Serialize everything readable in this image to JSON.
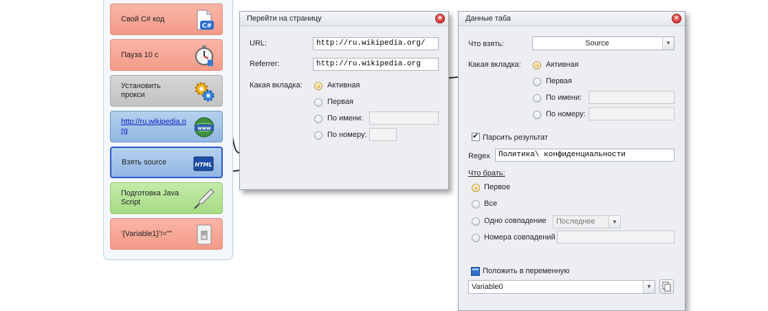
{
  "actions": [
    {
      "label": "Свой C# код",
      "icon": "csharp-code-icon",
      "color": "red"
    },
    {
      "label": "Пауза 10 с",
      "icon": "stopwatch-icon",
      "color": "red"
    },
    {
      "label": "Установить прокси",
      "icon": "gears-icon",
      "color": "gray"
    },
    {
      "label": "http://ru.wikipedia.org",
      "icon": "www-globe-icon",
      "color": "blue"
    },
    {
      "label": "Взять source",
      "icon": "html-icon",
      "color": "blue-selected"
    },
    {
      "label": "Подготовка Java Script",
      "icon": "pen-nib-icon",
      "color": "green"
    },
    {
      "label": "'{Variable1}'!=\"\"",
      "icon": "switch-icon",
      "color": "red"
    }
  ],
  "navigate_dialog": {
    "title": "Перейти на страницу",
    "url_label": "URL:",
    "url_value": "http://ru.wikipedia.org/",
    "referrer_label": "Referrer:",
    "referrer_value": "http://ru.wikipedia.org",
    "tab_label": "Какая вкладка:",
    "tab_options": [
      "Активная",
      "Первая",
      "По имени:",
      "По номеру:"
    ],
    "tab_selected": "Активная"
  },
  "tab_data_dialog": {
    "title": "Данные таба",
    "what_label": "Что взять:",
    "what_value": "Source",
    "tab_label": "Какая вкладка:",
    "tab_options": [
      "Активная",
      "Первая",
      "По имени:",
      "По номеру:"
    ],
    "tab_selected": "Активная",
    "parse_label": "Парсить результат",
    "parse_checked": true,
    "regex_label": "Regex",
    "regex_value": "Политика\\ конфиденциальности",
    "take_label": "Что брать:",
    "take_options": [
      "Первое",
      "Все",
      "Одно совпадение",
      "Номера совпадений"
    ],
    "take_selected": "Первое",
    "match_select_value": "Последнее",
    "save_var_label": "Положить в переменную",
    "variable_value": "Variable0"
  },
  "colors": {
    "selected_border": "#2c55c8",
    "link": "#1020c0",
    "close": "#c8201e"
  }
}
